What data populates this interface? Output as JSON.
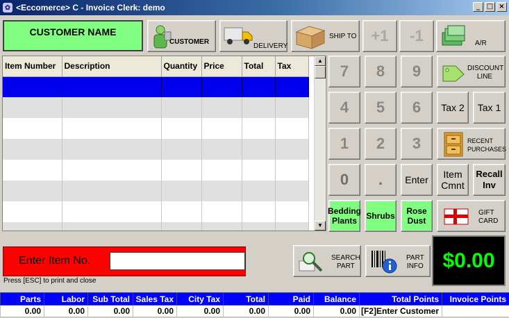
{
  "window": {
    "title": "<Eccomerce> C  - Invoice Clerk: demo",
    "min": "_",
    "max": "□",
    "close": "×"
  },
  "top": {
    "customer_name": "CUSTOMER NAME",
    "customer_btn": "CUSTOMER",
    "delivery_btn": "DELIVERY",
    "ship_to_btn": "SHIP TO",
    "plus_one": "+1",
    "minus_one": "-1",
    "ar_btn": "A/R"
  },
  "grid": {
    "columns": [
      "Item Number",
      "Description",
      "Quantity",
      "Price",
      "Total",
      "Tax"
    ],
    "scroll_up": "▲",
    "scroll_down": "▼"
  },
  "keypad": {
    "k7": "7",
    "k8": "8",
    "k9": "9",
    "k4": "4",
    "k5": "5",
    "k6": "6",
    "k1": "1",
    "k2": "2",
    "k3": "3",
    "k0": "0",
    "kdot": ".",
    "enter": "Enter",
    "discount_line_1": "DISCOUNT",
    "discount_line_2": "LINE",
    "tax2": "Tax 2",
    "tax1": "Tax 1",
    "recent_1": "RECENT",
    "recent_2": "PURCHASES",
    "item_cmnt_1": "Item",
    "item_cmnt_2": "Cmnt",
    "recall_1": "Recall",
    "recall_2": "Inv",
    "bedding_1": "Bedding",
    "bedding_2": "Plants",
    "shrubs": "Shrubs",
    "rose_1": "Rose",
    "rose_2": "Dust",
    "gift_1": "GIFT",
    "gift_2": "CARD"
  },
  "entry": {
    "label": "Enter Item No.",
    "value": "",
    "hint": "Press [ESC] to print and close"
  },
  "actions": {
    "search_1": "SEARCH",
    "search_2": "PART",
    "partinfo_1": "PART",
    "partinfo_2": "INFO"
  },
  "total_display": "$0.00",
  "footer": {
    "headers": [
      "Parts",
      "Labor",
      "Sub Total",
      "Sales Tax",
      "City Tax",
      "Total",
      "Paid",
      "Balance",
      "Total Points",
      "Invoice Points"
    ],
    "values": [
      "0.00",
      "0.00",
      "0.00",
      "0.00",
      "0.00",
      "0.00",
      "0.00",
      "0.00",
      "[F2]Enter Customer",
      ""
    ]
  }
}
